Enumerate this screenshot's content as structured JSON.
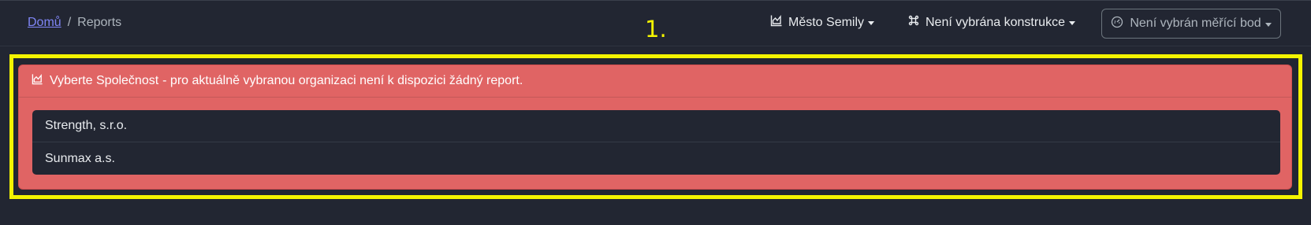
{
  "breadcrumb": {
    "home": "Domů",
    "separator": "/",
    "current": "Reports"
  },
  "nav": {
    "city": "Město Semily",
    "construction": "Není vybrána konstrukce",
    "measuring_point": "Není vybrán měřící bod"
  },
  "annotation": {
    "number": "1."
  },
  "alert": {
    "title": "Vyberte Společnost",
    "message": "- pro aktuálně vybranou organizaci není k dispozici žádný report."
  },
  "companies": [
    {
      "name": "Strength, s.r.o."
    },
    {
      "name": "Sunmax a.s."
    }
  ],
  "colors": {
    "background": "#222632",
    "alert": "#e06464",
    "annotation": "#f4f400",
    "link": "#7f85f5"
  },
  "icons": {
    "city": "chart-area-icon",
    "construction": "command-icon",
    "measuring_point": "gauge-icon",
    "alert": "chart-area-icon"
  }
}
